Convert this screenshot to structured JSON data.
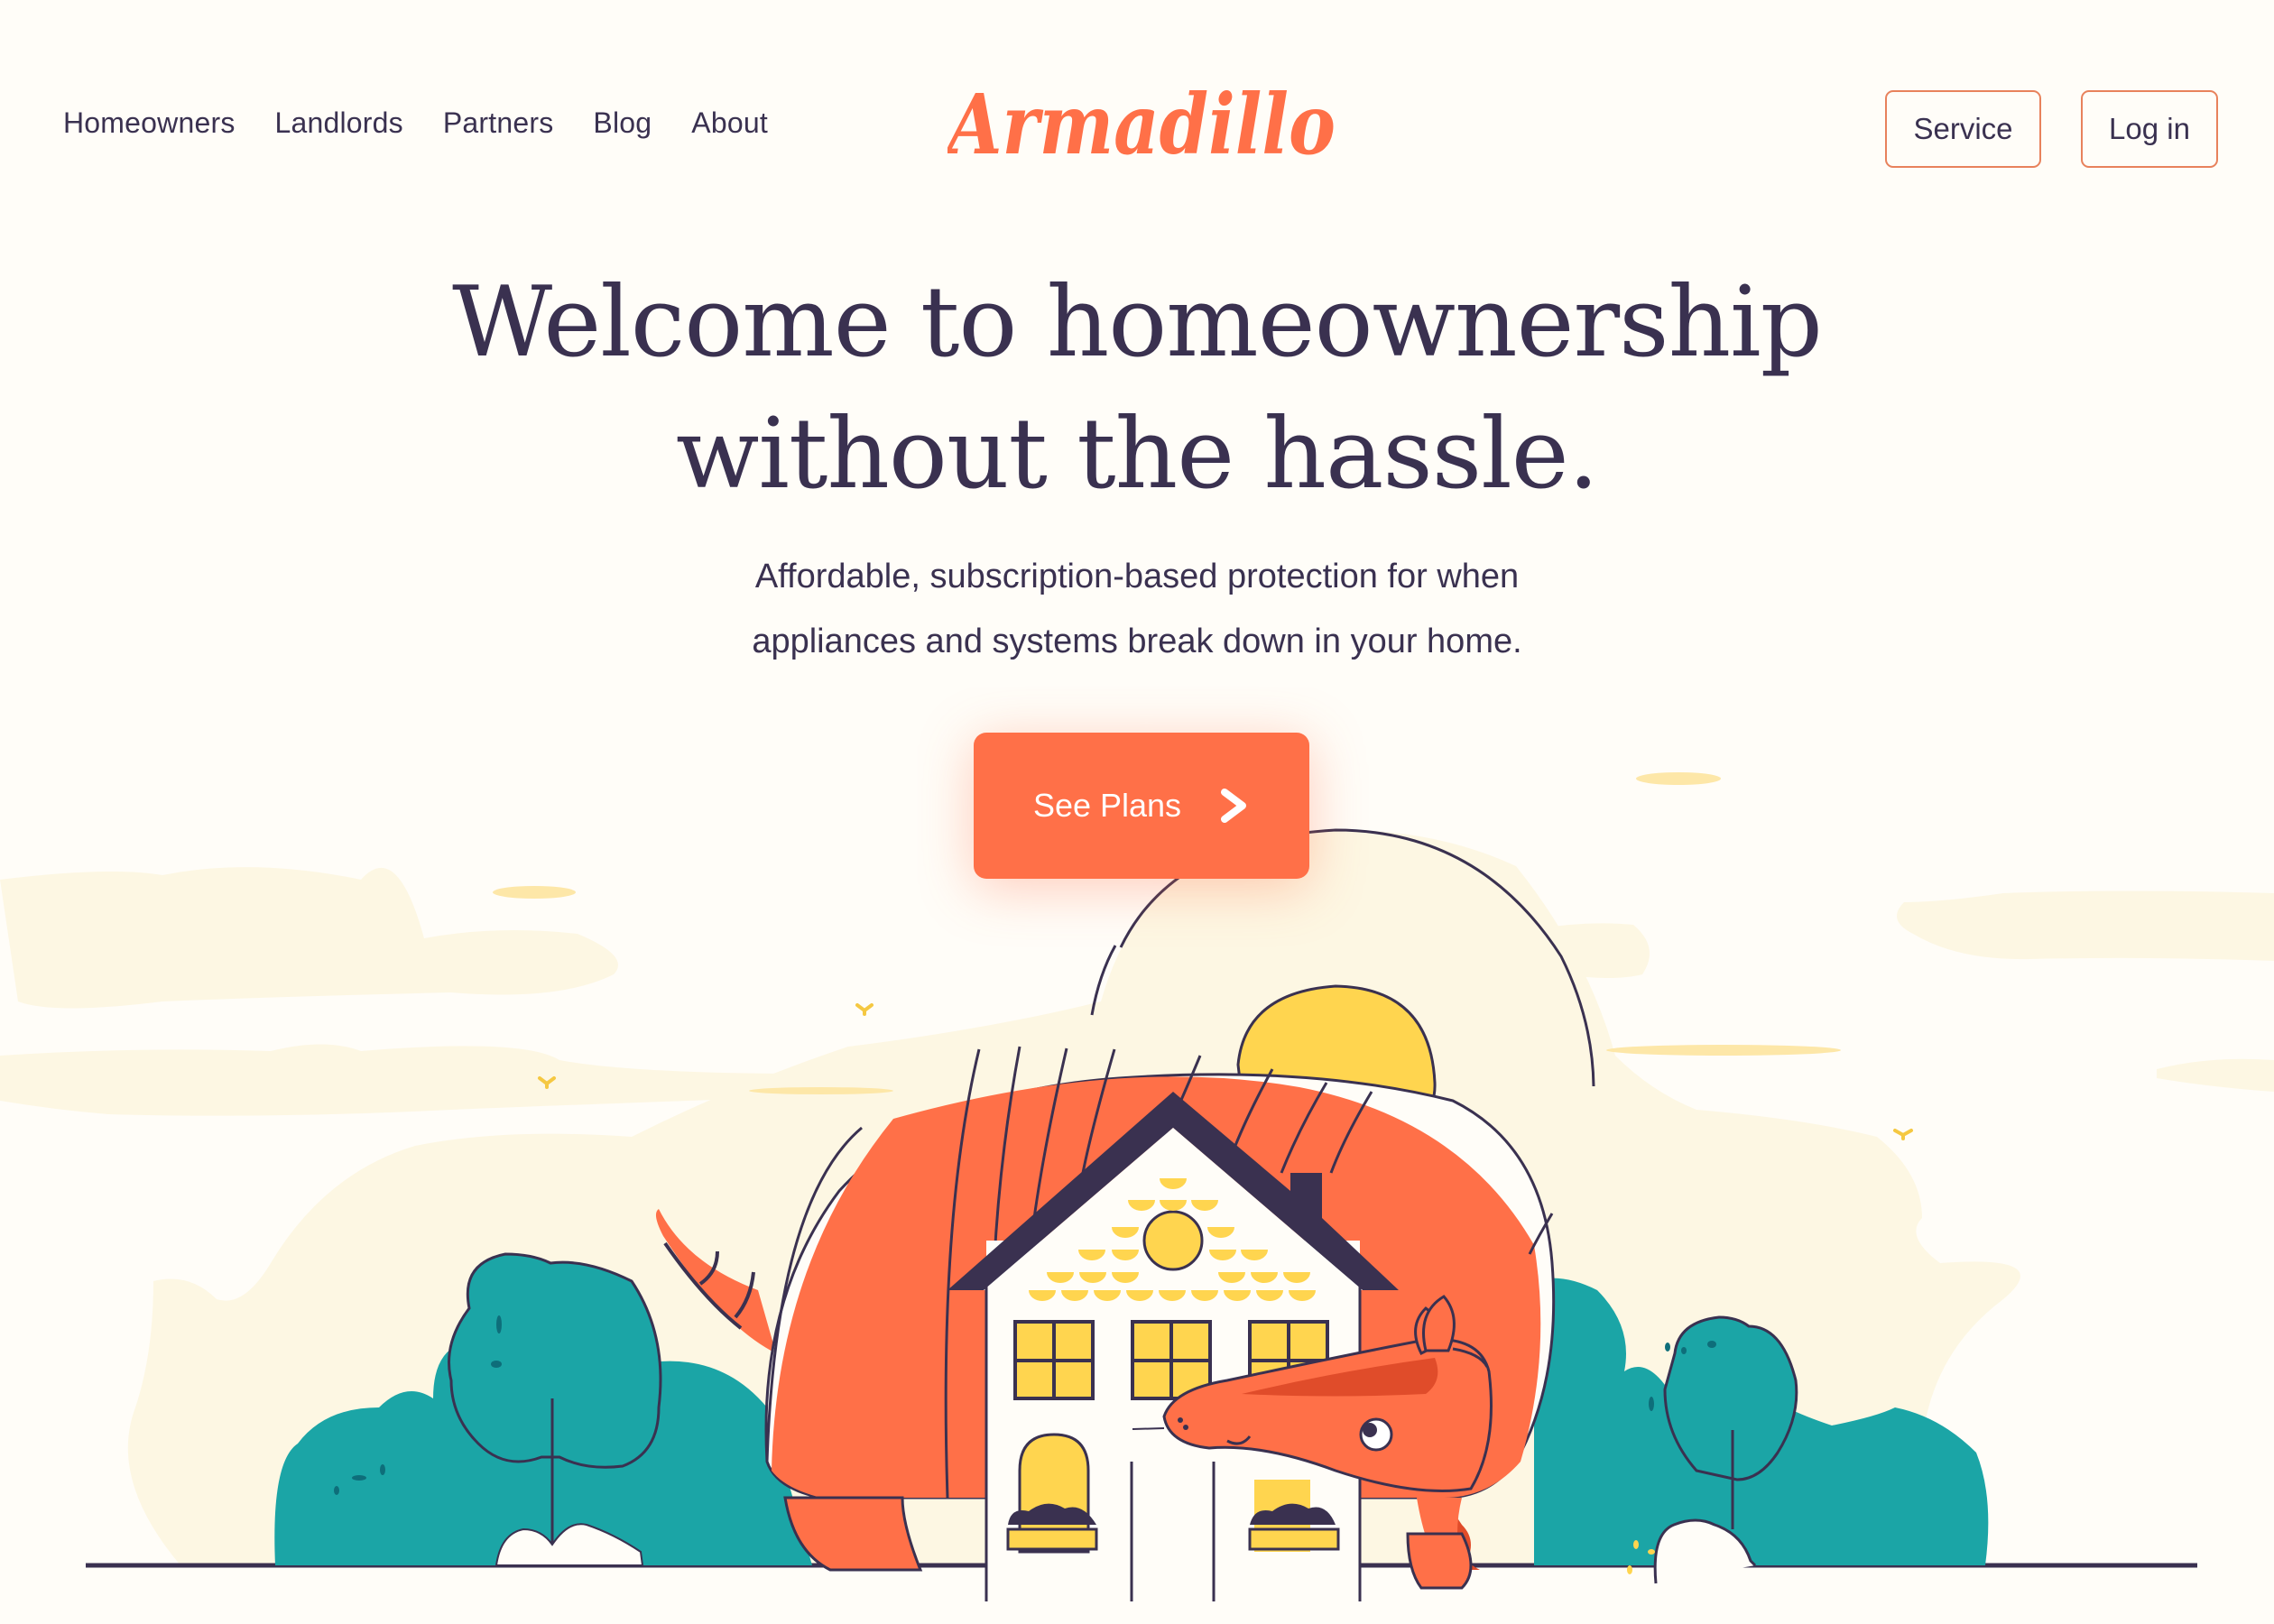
{
  "nav": {
    "links": [
      {
        "label": "Homeowners"
      },
      {
        "label": "Landlords"
      },
      {
        "label": "Partners"
      },
      {
        "label": "Blog"
      },
      {
        "label": "About"
      }
    ]
  },
  "brand": {
    "logo_text": "Armadillo",
    "accent_color": "#ff7048"
  },
  "header_actions": {
    "service_label": "Service",
    "login_label": "Log in"
  },
  "hero": {
    "headline_line1": "Welcome to homeownership",
    "headline_line2": "without the hassle.",
    "subhead_line1": "Affordable, subscription-based protection for when",
    "subhead_line2": "appliances and systems break down in your home.",
    "cta_label": "See Plans",
    "cta_icon": "chevron-right-icon"
  },
  "illustration": {
    "subject": "armadillo curled around a house",
    "colors": {
      "orange": "#ff7048",
      "dark": "#3a3150",
      "yellow": "#ffd54f",
      "teal": "#1ba5a6",
      "cream": "#fdf7e3"
    }
  }
}
